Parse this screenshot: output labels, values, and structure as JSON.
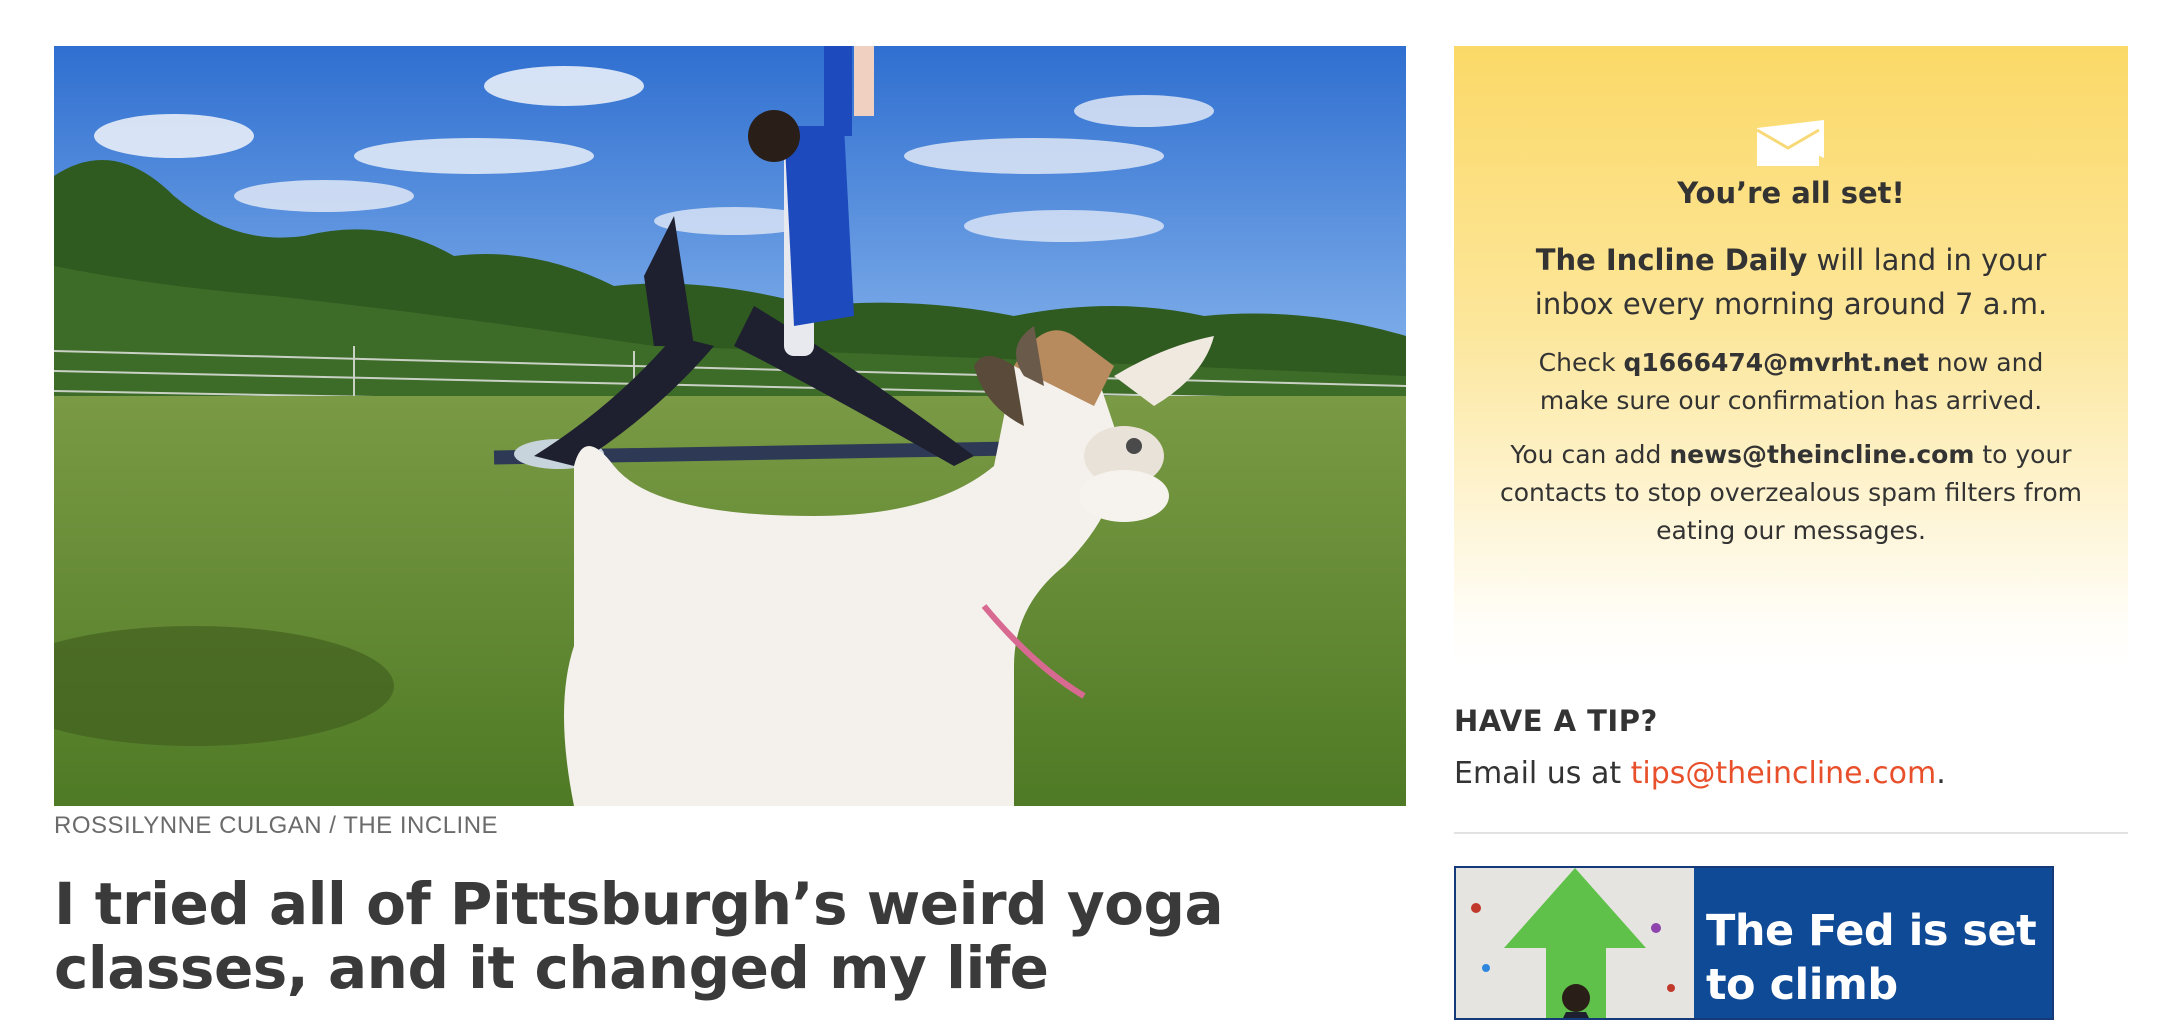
{
  "article": {
    "image_alt": "Woman doing yoga in a field with a baby goat in the foreground",
    "photo_credit": "ROSSILYNNE CULGAN / THE INCLINE",
    "headline": "I tried all of Pittsburgh’s weird yoga classes, and it changed my life"
  },
  "newsletter": {
    "icon": "envelope-icon",
    "title": "You’re all set!",
    "line1_bold": "The Incline Daily",
    "line1_rest": " will land in your inbox every morning around 7 a.m.",
    "line2_pre": "Check ",
    "line2_email": "q1666474@mvrht.net",
    "line2_post": " now and make sure our confirmation has arrived.",
    "line3_pre": "You can add ",
    "line3_email": "news@theincline.com",
    "line3_post": " to your contacts to stop overzealous spam filters from eating our messages.",
    "bg_color": "#fbd968"
  },
  "tip": {
    "title": "HAVE A TIP?",
    "text_pre": "Email us at ",
    "email": "tips@theincline.com",
    "text_post": ".",
    "link_color": "#e8502b"
  },
  "ad": {
    "text": "The Fed is set to climb",
    "bg_color": "#0f4a96"
  }
}
